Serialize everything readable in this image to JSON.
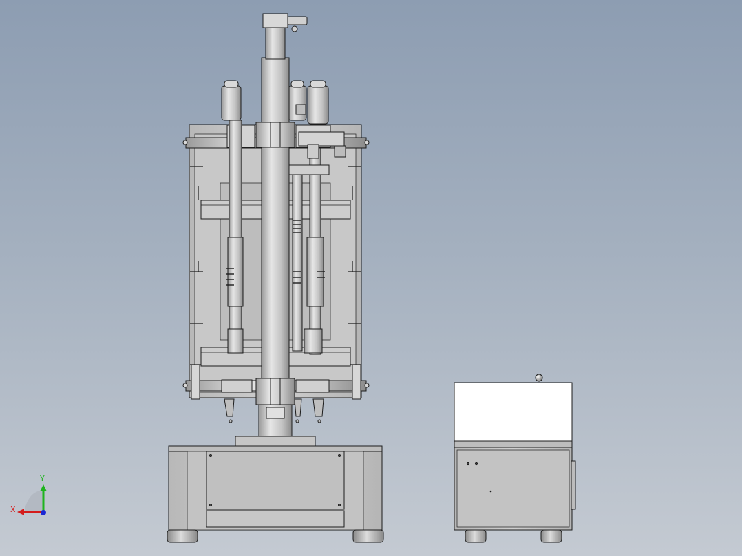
{
  "triad": {
    "x_label": "X",
    "y_label": "Y",
    "x_color": "#d41c1c",
    "y_color": "#1eb41e",
    "z_color": "#1c28d4"
  },
  "colors": {
    "background_top": "#8d9db2",
    "background_bottom": "#c4cad2",
    "model_body": "#c9c9c9",
    "model_edge": "#1c1c1c",
    "panel_white": "#ffffff"
  }
}
